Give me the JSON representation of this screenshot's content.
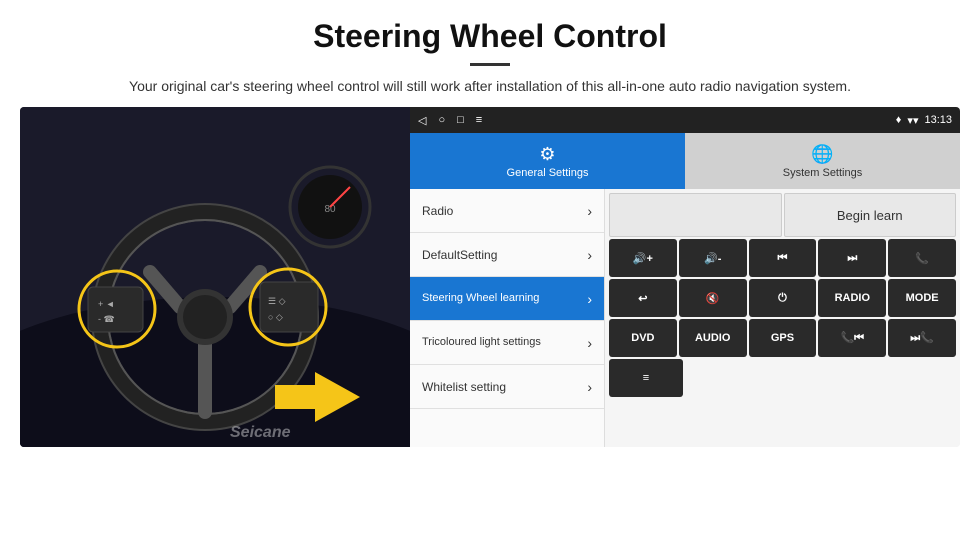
{
  "page": {
    "title": "Steering Wheel Control",
    "subtitle": "Your original car's steering wheel control will still work after installation of this all-in-one auto radio navigation system.",
    "divider": "—"
  },
  "status_bar": {
    "back_icon": "◁",
    "home_icon": "○",
    "recents_icon": "□",
    "menu_icon": "≡",
    "signal_icon": "▾",
    "wifi_icon": "▾",
    "time": "13:13"
  },
  "tabs": [
    {
      "id": "general",
      "label": "General Settings",
      "icon": "⚙",
      "active": true
    },
    {
      "id": "system",
      "label": "System Settings",
      "icon": "🌐",
      "active": false
    }
  ],
  "menu_items": [
    {
      "label": "Radio",
      "active": false
    },
    {
      "label": "DefaultSetting",
      "active": false
    },
    {
      "label": "Steering Wheel learning",
      "active": true
    },
    {
      "label": "Tricoloured light settings",
      "active": false
    },
    {
      "label": "Whitelist setting",
      "active": false
    }
  ],
  "begin_learn_button": "Begin learn",
  "control_buttons": {
    "row1": [
      {
        "label": "🔊+",
        "id": "vol-up"
      },
      {
        "label": "🔊-",
        "id": "vol-down"
      },
      {
        "label": "⏮",
        "id": "prev"
      },
      {
        "label": "⏭",
        "id": "next"
      },
      {
        "label": "📞",
        "id": "phone"
      }
    ],
    "row2": [
      {
        "label": "↩",
        "id": "hangup"
      },
      {
        "label": "🔇",
        "id": "mute"
      },
      {
        "label": "⏻",
        "id": "power"
      },
      {
        "label": "RADIO",
        "id": "radio"
      },
      {
        "label": "MODE",
        "id": "mode"
      }
    ],
    "row3": [
      {
        "label": "DVD",
        "id": "dvd"
      },
      {
        "label": "AUDIO",
        "id": "audio"
      },
      {
        "label": "GPS",
        "id": "gps"
      },
      {
        "label": "📞⏮",
        "id": "call-prev"
      },
      {
        "label": "⏭📞",
        "id": "call-next"
      }
    ],
    "row4": [
      {
        "label": "≡",
        "id": "menu-btn"
      }
    ]
  },
  "watermark": "Seicane"
}
